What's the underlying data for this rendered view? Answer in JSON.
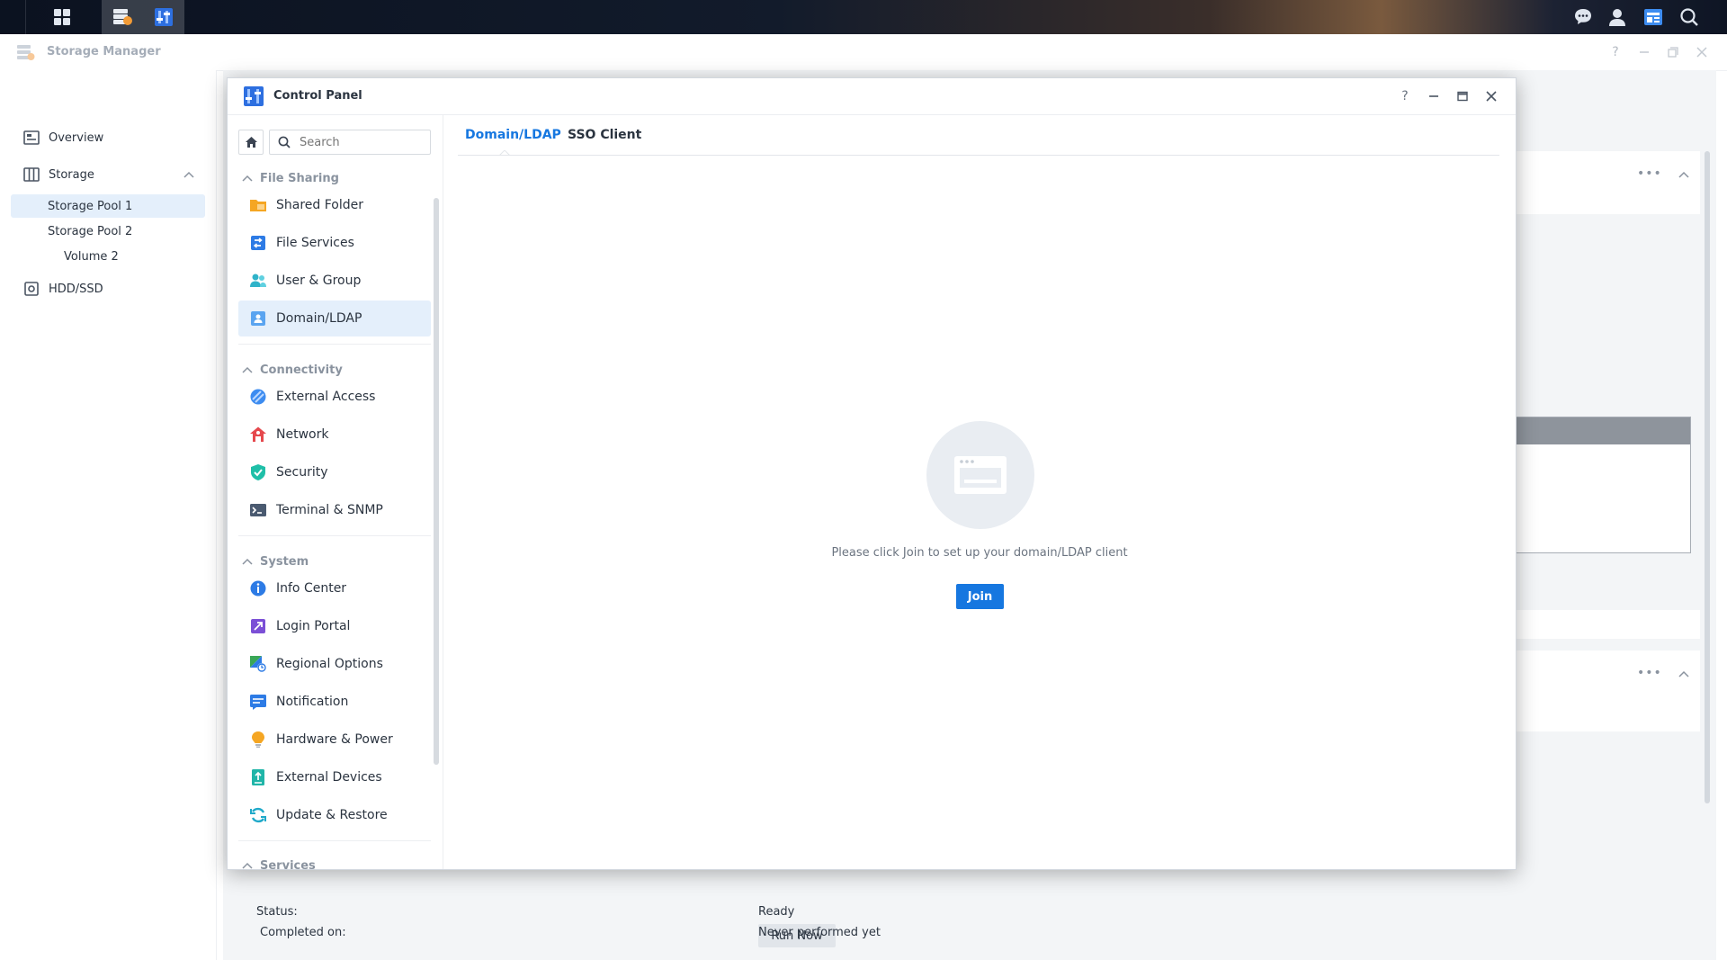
{
  "storage_manager": {
    "title": "Storage Manager",
    "sidebar": {
      "overview": "Overview",
      "storage": "Storage",
      "pool1": "Storage Pool 1",
      "pool2": "Storage Pool 2",
      "volume2": "Volume 2",
      "hdd": "HDD/SSD"
    },
    "content": {
      "status_label": "Status:",
      "status_value": "Ready",
      "run_now": "Run Now",
      "completed_label": "Completed on:",
      "completed_value": "Never performed yet"
    }
  },
  "control_panel": {
    "title": "Control Panel",
    "search_placeholder": "Search",
    "sections": {
      "file_sharing": "File Sharing",
      "connectivity": "Connectivity",
      "system": "System",
      "services": "Services"
    },
    "items": {
      "shared_folder": "Shared Folder",
      "file_services": "File Services",
      "user_group": "User & Group",
      "domain_ldap": "Domain/LDAP",
      "external_access": "External Access",
      "network": "Network",
      "security": "Security",
      "terminal_snmp": "Terminal & SNMP",
      "info_center": "Info Center",
      "login_portal": "Login Portal",
      "regional_options": "Regional Options",
      "notification": "Notification",
      "hardware_power": "Hardware & Power",
      "external_devices": "External Devices",
      "update_restore": "Update & Restore"
    },
    "tabs": {
      "domain_ldap": "Domain/LDAP",
      "sso_client": "SSO Client"
    },
    "empty_message": "Please click Join to set up your domain/LDAP client",
    "join_label": "Join"
  },
  "colors": {
    "accent": "#1677e0",
    "selected_bg": "#e4effb"
  }
}
